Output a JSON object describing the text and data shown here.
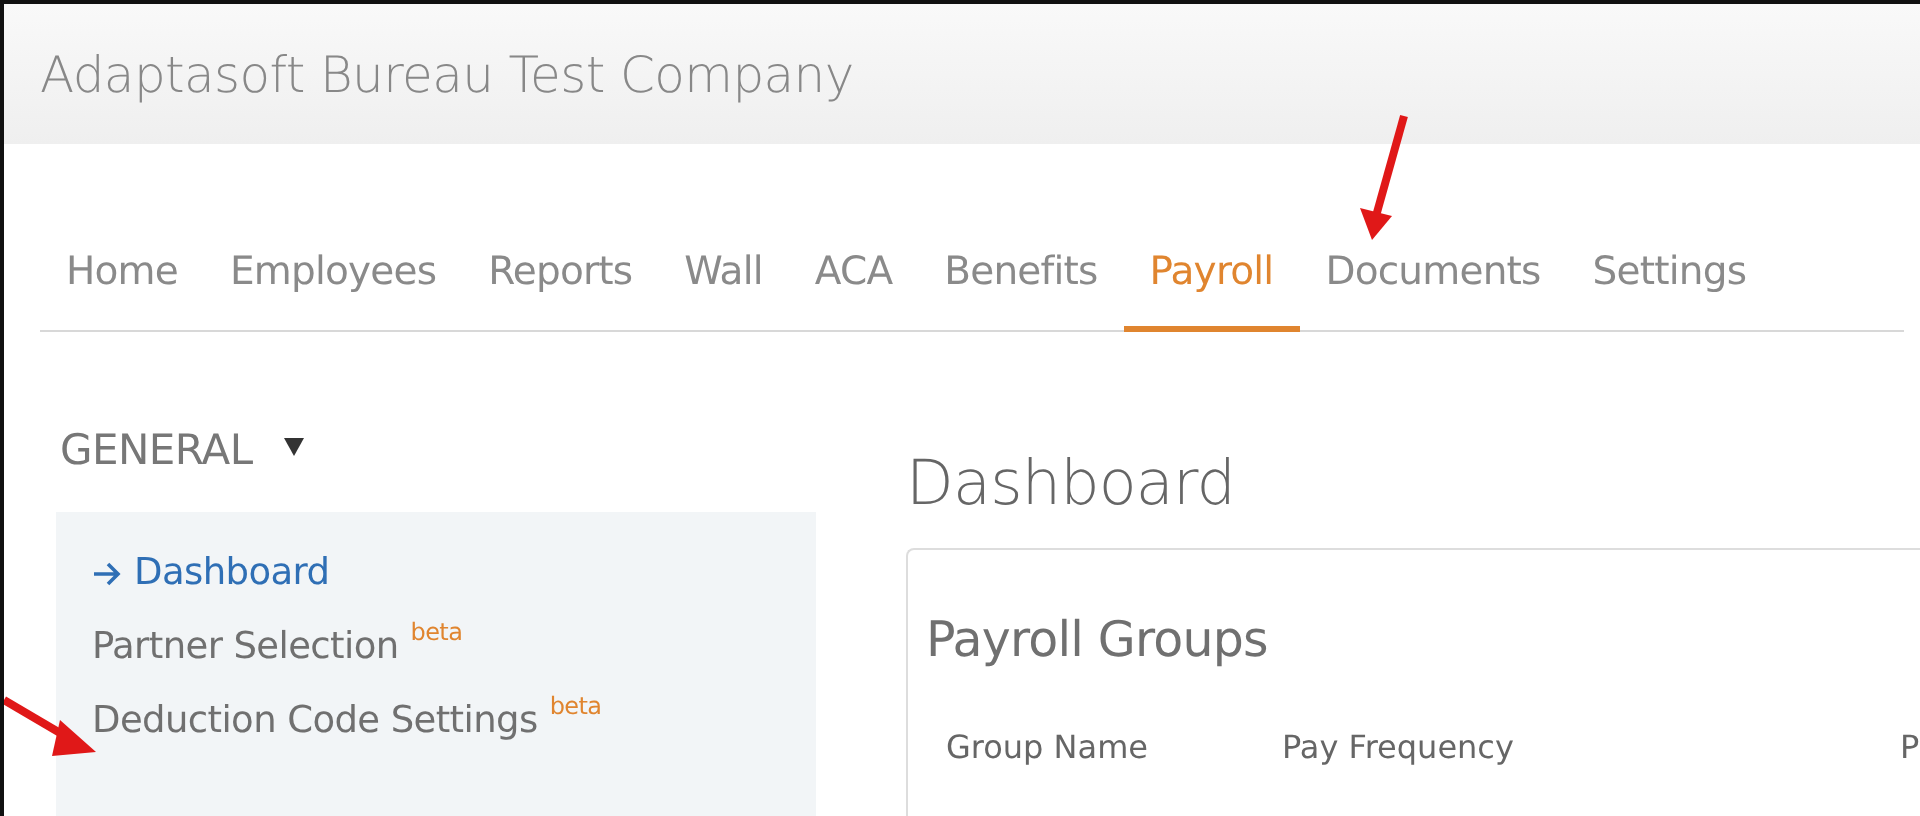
{
  "header": {
    "title": "Adaptasoft Bureau Test Company"
  },
  "tabs": [
    {
      "label": "Home",
      "selected": false
    },
    {
      "label": "Employees",
      "selected": false
    },
    {
      "label": "Reports",
      "selected": false
    },
    {
      "label": "Wall",
      "selected": false
    },
    {
      "label": "ACA",
      "selected": false
    },
    {
      "label": "Benefits",
      "selected": false
    },
    {
      "label": "Payroll",
      "selected": true
    },
    {
      "label": "Documents",
      "selected": false
    },
    {
      "label": "Settings",
      "selected": false
    }
  ],
  "sidebar": {
    "section": "GENERAL",
    "expanded": true,
    "items": [
      {
        "label": "Dashboard",
        "selected": true
      },
      {
        "label": "Partner Selection",
        "badge": "beta",
        "selected": false
      },
      {
        "label": "Deduction Code Settings",
        "badge": "beta",
        "selected": false
      }
    ]
  },
  "main": {
    "title": "Dashboard",
    "card": {
      "title": "Payroll Groups",
      "columns": [
        "Group Name",
        "Pay Frequency",
        "P"
      ]
    }
  }
}
